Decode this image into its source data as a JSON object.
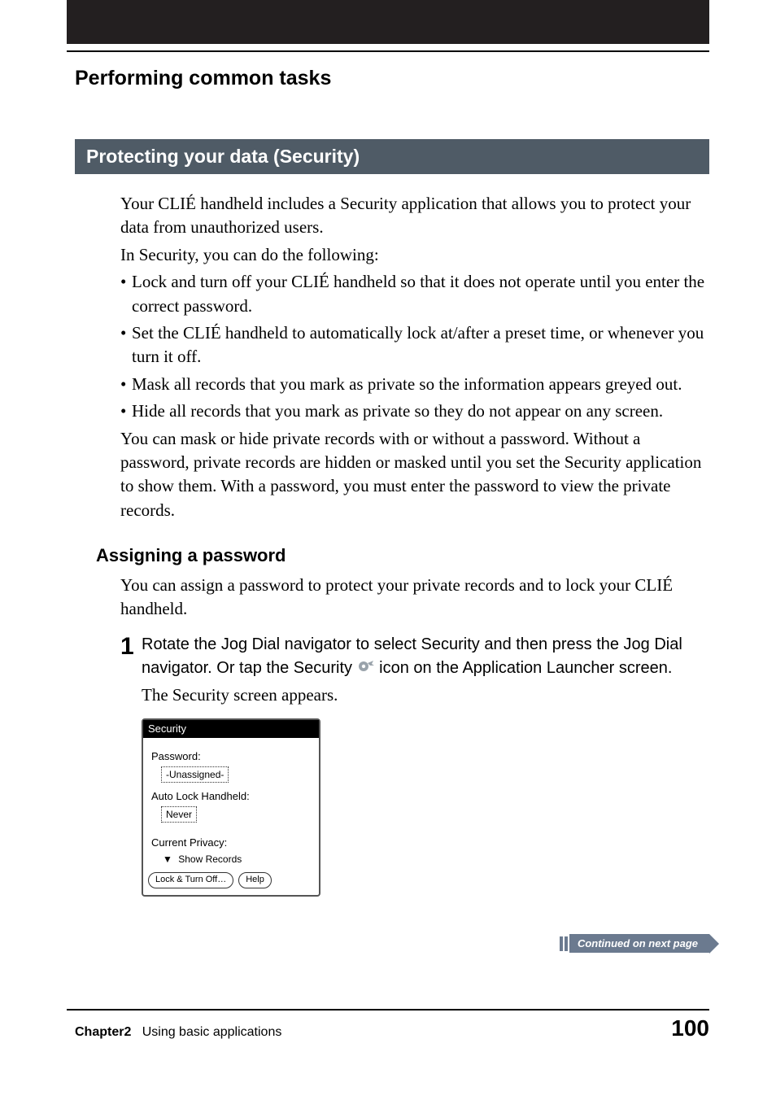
{
  "header": {
    "breadcrumb": "Performing common tasks"
  },
  "section": {
    "title": "Protecting your data (Security)"
  },
  "intro": {
    "p1": "Your CLIÉ handheld includes a Security application that allows you to protect your data from unauthorized users.",
    "p2": "In Security, you can do the following:"
  },
  "bullets": [
    "Lock and turn off your CLIÉ handheld so that it does not operate until you enter the correct password.",
    "Set the CLIÉ handheld to automatically lock at/after a preset time, or whenever you turn it off.",
    "Mask all records that you mark as private so the information appears greyed out.",
    "Hide all records that you mark as private so they do not appear on any screen."
  ],
  "after_bullets": "You can mask or hide private records with or without a password. Without a password, private records are hidden or masked until you set the Security application to show them. With a password, you must enter the password to view the private records.",
  "assign": {
    "heading": "Assigning a password",
    "p": "You can assign a password to protect your private records and to lock your CLIÉ handheld."
  },
  "step1": {
    "num": "1",
    "text_before_icon": "Rotate the Jog Dial navigator to select Security and then press the Jog Dial navigator. Or tap the Security ",
    "text_after_icon": " icon on the Application Launcher screen.",
    "follow": "The Security screen appears."
  },
  "sec_screen": {
    "title": "Security",
    "password_label": "Password:",
    "password_value": "-Unassigned-",
    "autolock_label": "Auto Lock Handheld:",
    "autolock_value": "Never",
    "privacy_label": "Current Privacy:",
    "privacy_value": "Show Records",
    "btn_lock": "Lock & Turn Off…",
    "btn_help": "Help"
  },
  "continued": "Continued on next page",
  "footer": {
    "chapter": "Chapter2",
    "chapter_title": "Using basic applications",
    "page": "100"
  }
}
